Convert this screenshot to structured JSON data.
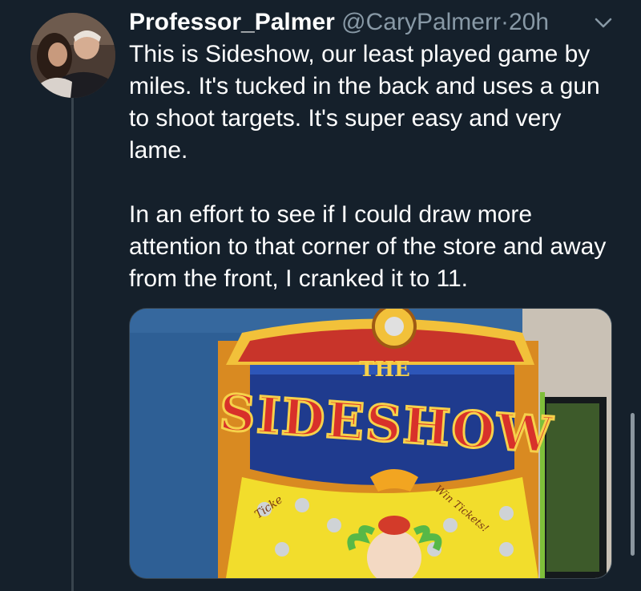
{
  "tweet": {
    "display_name": "Professor_Palmer",
    "handle": "@CaryPalmerr",
    "separator": "·",
    "time": "20h",
    "paragraphs": [
      "This is Sideshow, our least played game by miles. It's tucked in the back and uses a gun to shoot targets. It's super easy and very lame.",
      "In an effort to see if I could draw more attention to that corner of the store and away from the front, I cranked it to 11."
    ]
  },
  "media": {
    "sign_top": "THE",
    "sign_main": "SIDESHOW",
    "side_left": "Ticke",
    "side_right": "Win Tickets!"
  },
  "icons": {
    "caret": "chevron-down-icon",
    "avatar": "user-avatar"
  },
  "colors": {
    "background": "#15202b",
    "secondary_text": "#8899a6",
    "divider": "#38444d"
  }
}
